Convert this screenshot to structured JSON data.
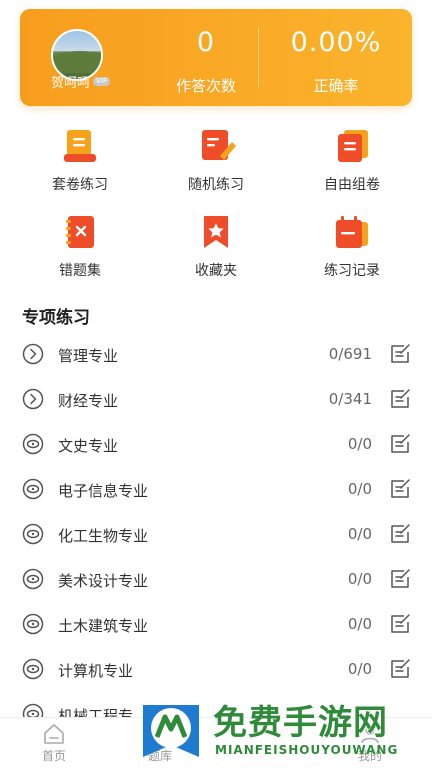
{
  "header": {
    "user_name": "贺呵呵",
    "vip_badge": "VIP",
    "answer_count": "0",
    "answer_count_label": "作答次数",
    "accuracy": "0.00%",
    "accuracy_label": "正确率",
    "accent_color": "#f79d1e"
  },
  "grid": [
    {
      "label": "套卷练习",
      "icon": "scroll-list-icon"
    },
    {
      "label": "随机练习",
      "icon": "note-edit-icon"
    },
    {
      "label": "自由组卷",
      "icon": "stacked-papers-icon"
    },
    {
      "label": "错题集",
      "icon": "wrong-book-icon"
    },
    {
      "label": "收藏夹",
      "icon": "star-bookmark-icon"
    },
    {
      "label": "练习记录",
      "icon": "calendar-record-icon"
    }
  ],
  "section": {
    "title": "专项练习",
    "items": [
      {
        "label": "管理专业",
        "count": "0/691",
        "icon": "chevron-circle-icon"
      },
      {
        "label": "财经专业",
        "count": "0/341",
        "icon": "chevron-circle-icon"
      },
      {
        "label": "文史专业",
        "count": "0/0",
        "icon": "eye-circle-icon"
      },
      {
        "label": "电子信息专业",
        "count": "0/0",
        "icon": "eye-circle-icon"
      },
      {
        "label": "化工生物专业",
        "count": "0/0",
        "icon": "eye-circle-icon"
      },
      {
        "label": "美术设计专业",
        "count": "0/0",
        "icon": "eye-circle-icon"
      },
      {
        "label": "土木建筑专业",
        "count": "0/0",
        "icon": "eye-circle-icon"
      },
      {
        "label": "计算机专业",
        "count": "0/0",
        "icon": "eye-circle-icon"
      },
      {
        "label": "机械工程专",
        "count": "",
        "icon": "eye-circle-icon"
      }
    ]
  },
  "tabbar": {
    "home_label": "首页",
    "second_label": "题库",
    "third_label": "我的"
  },
  "watermark": {
    "title": "免费手游网",
    "subtitle": "MIANFEISHOUYOUWANG"
  }
}
